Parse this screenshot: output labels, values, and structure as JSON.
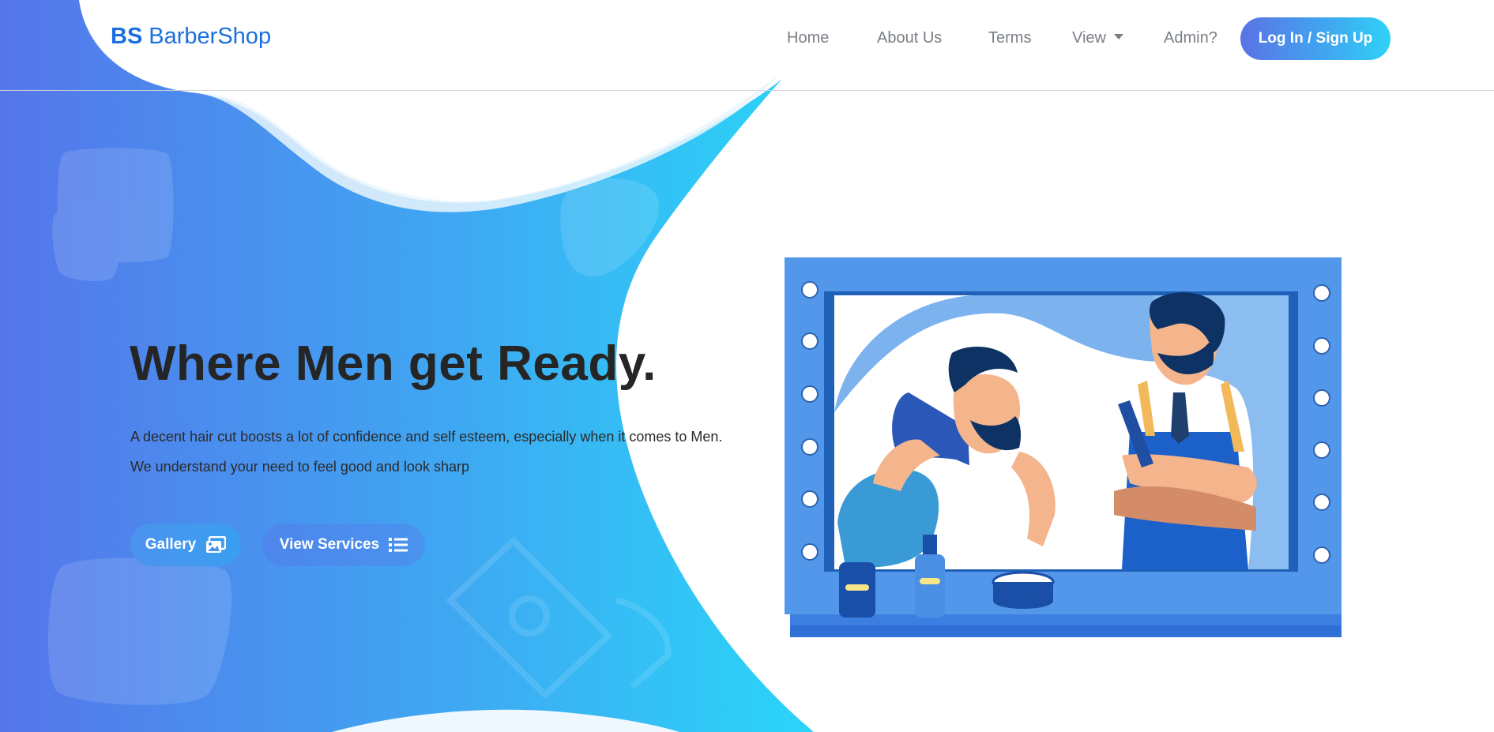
{
  "brand": {
    "bold": "BS",
    "name": "BarberShop"
  },
  "nav": {
    "home": "Home",
    "about": "About Us",
    "terms": "Terms",
    "view": "View",
    "admin": "Admin?",
    "login": "Log In / Sign Up"
  },
  "hero": {
    "title": "Where Men get Ready.",
    "description": "A decent hair cut boosts a lot of confidence and self esteem, especially when it comes to Men. We understand your need to feel good and look sharp",
    "gallery_button": "Gallery",
    "services_button": "View Services"
  },
  "icons": {
    "gallery": "images-icon",
    "services": "list-icon",
    "view_dropdown": "caret-down-icon"
  },
  "colors": {
    "brand": "#1b6fe0",
    "gradient_start": "#5a73e6",
    "gradient_end": "#2fd3f7",
    "title": "#252525",
    "nav_text": "#7a7f85"
  }
}
